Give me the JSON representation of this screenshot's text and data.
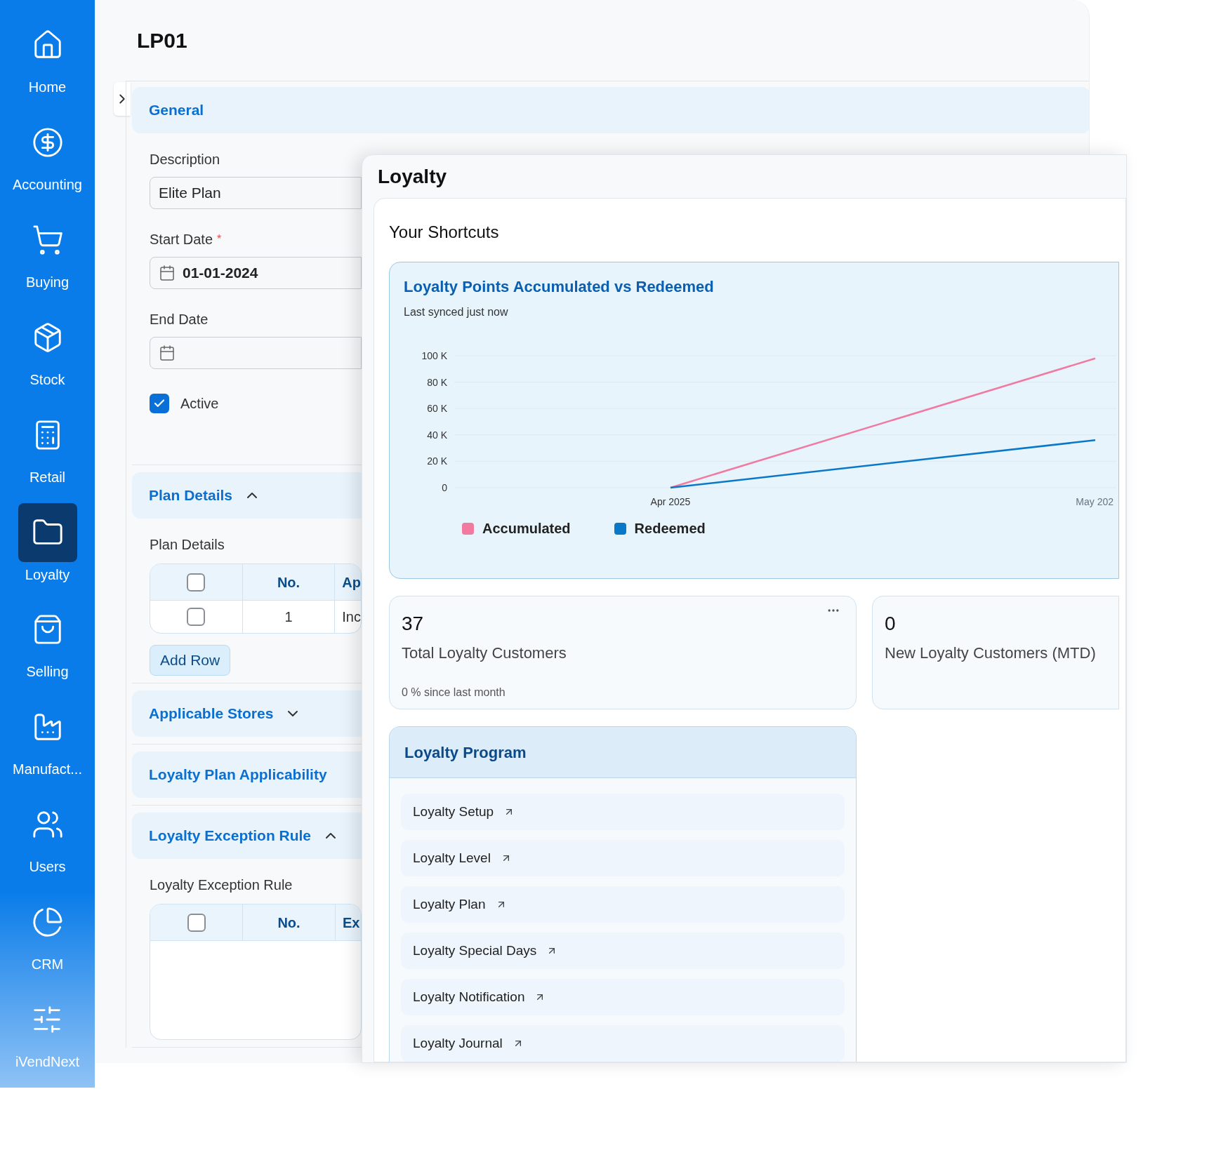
{
  "sidebar": {
    "items": [
      {
        "label": "Home",
        "selected": false
      },
      {
        "label": "Accounting",
        "selected": false
      },
      {
        "label": "Buying",
        "selected": false
      },
      {
        "label": "Stock",
        "selected": false
      },
      {
        "label": "Retail",
        "selected": false
      },
      {
        "label": "Loyalty",
        "selected": true
      },
      {
        "label": "Selling",
        "selected": false
      },
      {
        "label": "Manufact...",
        "selected": false
      },
      {
        "label": "Users",
        "selected": false
      },
      {
        "label": "CRM",
        "selected": false
      },
      {
        "label": "iVendNext",
        "selected": false
      }
    ]
  },
  "page": {
    "title": "LP01"
  },
  "general": {
    "title": "General",
    "fields": [
      {
        "kind": "text",
        "label": "Description",
        "value": "Elite Plan"
      },
      {
        "kind": "date",
        "label": "Start Date",
        "required_mark": "*",
        "value": "01-01-2024"
      },
      {
        "kind": "date",
        "label": "End Date"
      },
      {
        "kind": "checkbox",
        "label": "Active",
        "checked": true
      }
    ]
  },
  "sections": [
    {
      "title": "Plan Details",
      "expanded": true,
      "table": {
        "label": "Plan Details",
        "header_checked": false,
        "columns": [
          "No.",
          "Ap"
        ],
        "rows": [
          {
            "checked": false,
            "cells": [
              "1",
              "Inc"
            ]
          }
        ]
      },
      "button": "Add Row"
    },
    {
      "title": "Applicable Stores",
      "expanded": false
    },
    {
      "title": "Loyalty Plan Applicability"
    },
    {
      "title": "Loyalty Exception Rule",
      "expanded": true,
      "table": {
        "label": "Loyalty Exception Rule",
        "header_checked": false,
        "columns": [
          "No.",
          "Ex"
        ]
      }
    }
  ],
  "workspace": {
    "title": "Loyalty",
    "shortcuts_title": "Your Shortcuts",
    "chart_card": {
      "title": "Loyalty Points Accumulated vs Redeemed",
      "subtitle": "Last synced just now",
      "chart_data": {
        "type": "line",
        "grid": true,
        "categories": [
          "Apr 2025",
          "May 202"
        ],
        "ylim": [
          0,
          100000
        ],
        "yticks": [
          {
            "value": 0,
            "label": "0"
          },
          {
            "value": 20000,
            "label": "20 K"
          },
          {
            "value": 40000,
            "label": "40 K"
          },
          {
            "value": 60000,
            "label": "60 K"
          },
          {
            "value": 80000,
            "label": "80 K"
          },
          {
            "value": 100000,
            "label": "100 K"
          }
        ],
        "series": [
          {
            "name": "Accumulated",
            "color": "#f07aa0",
            "values": [
              0,
              98000
            ]
          },
          {
            "name": "Redeemed",
            "color": "#0a78c8",
            "values": [
              0,
              36000
            ]
          }
        ]
      }
    },
    "stats": [
      {
        "value": "37",
        "label": "Total Loyalty Customers",
        "note": "0 % since last month"
      },
      {
        "value": "0",
        "label": "New Loyalty Customers (MTD)"
      }
    ],
    "program": {
      "title": "Loyalty Program",
      "links": [
        {
          "label": "Loyalty Setup"
        },
        {
          "label": "Loyalty Level"
        },
        {
          "label": "Loyalty Plan"
        },
        {
          "label": "Loyalty Special Days"
        },
        {
          "label": "Loyalty Notification"
        },
        {
          "label": "Loyalty Journal"
        }
      ]
    }
  }
}
